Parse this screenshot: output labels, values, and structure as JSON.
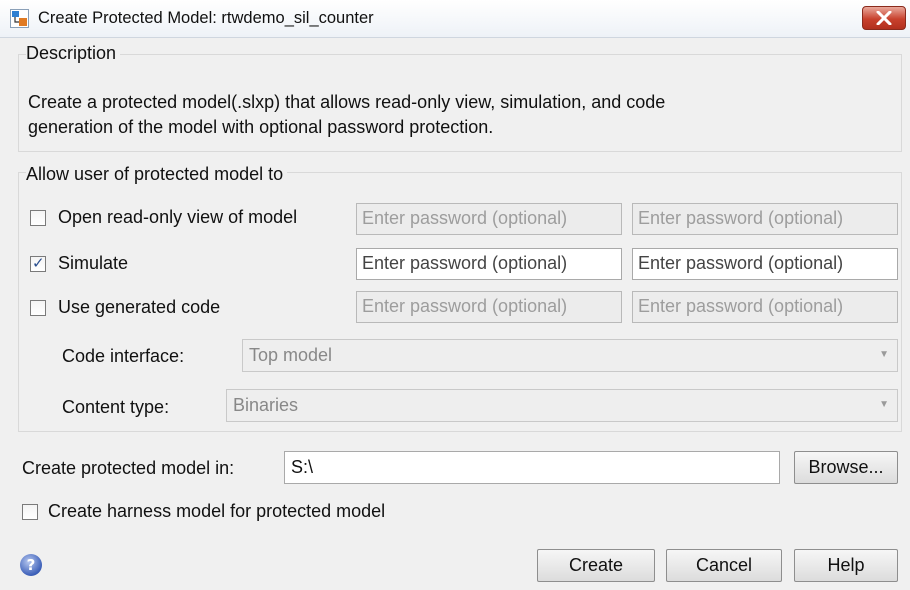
{
  "window": {
    "title": "Create Protected Model: rtwdemo_sil_counter"
  },
  "description": {
    "legend": "Description",
    "line1": "Create a protected model(.slxp) that allows read-only view, simulation, and code",
    "line2": "generation of the model with optional password protection."
  },
  "allow": {
    "legend": "Allow user of protected model to",
    "options": [
      {
        "label": "Open read-only view of model",
        "checked": false,
        "pw1": "Enter password (optional)",
        "pw2": "Enter password (optional)"
      },
      {
        "label": "Simulate",
        "checked": true,
        "pw1": "Enter password (optional)",
        "pw2": "Enter password (optional)"
      },
      {
        "label": "Use generated code",
        "checked": false,
        "pw1": "Enter password (optional)",
        "pw2": "Enter password (optional)"
      }
    ],
    "code_interface": {
      "label": "Code interface:",
      "value": "Top model"
    },
    "content_type": {
      "label": "Content type:",
      "value": "Binaries"
    }
  },
  "location": {
    "label": "Create protected model in:",
    "value": "S:\\",
    "browse_label": "Browse..."
  },
  "harness": {
    "label": "Create harness model for protected model",
    "checked": false
  },
  "footer": {
    "create_label": "Create",
    "cancel_label": "Cancel",
    "help_label": "Help",
    "help_icon_glyph": "?"
  },
  "colors": {
    "close_button": "#c8412d",
    "dialog_bg": "#f0f0f0"
  }
}
